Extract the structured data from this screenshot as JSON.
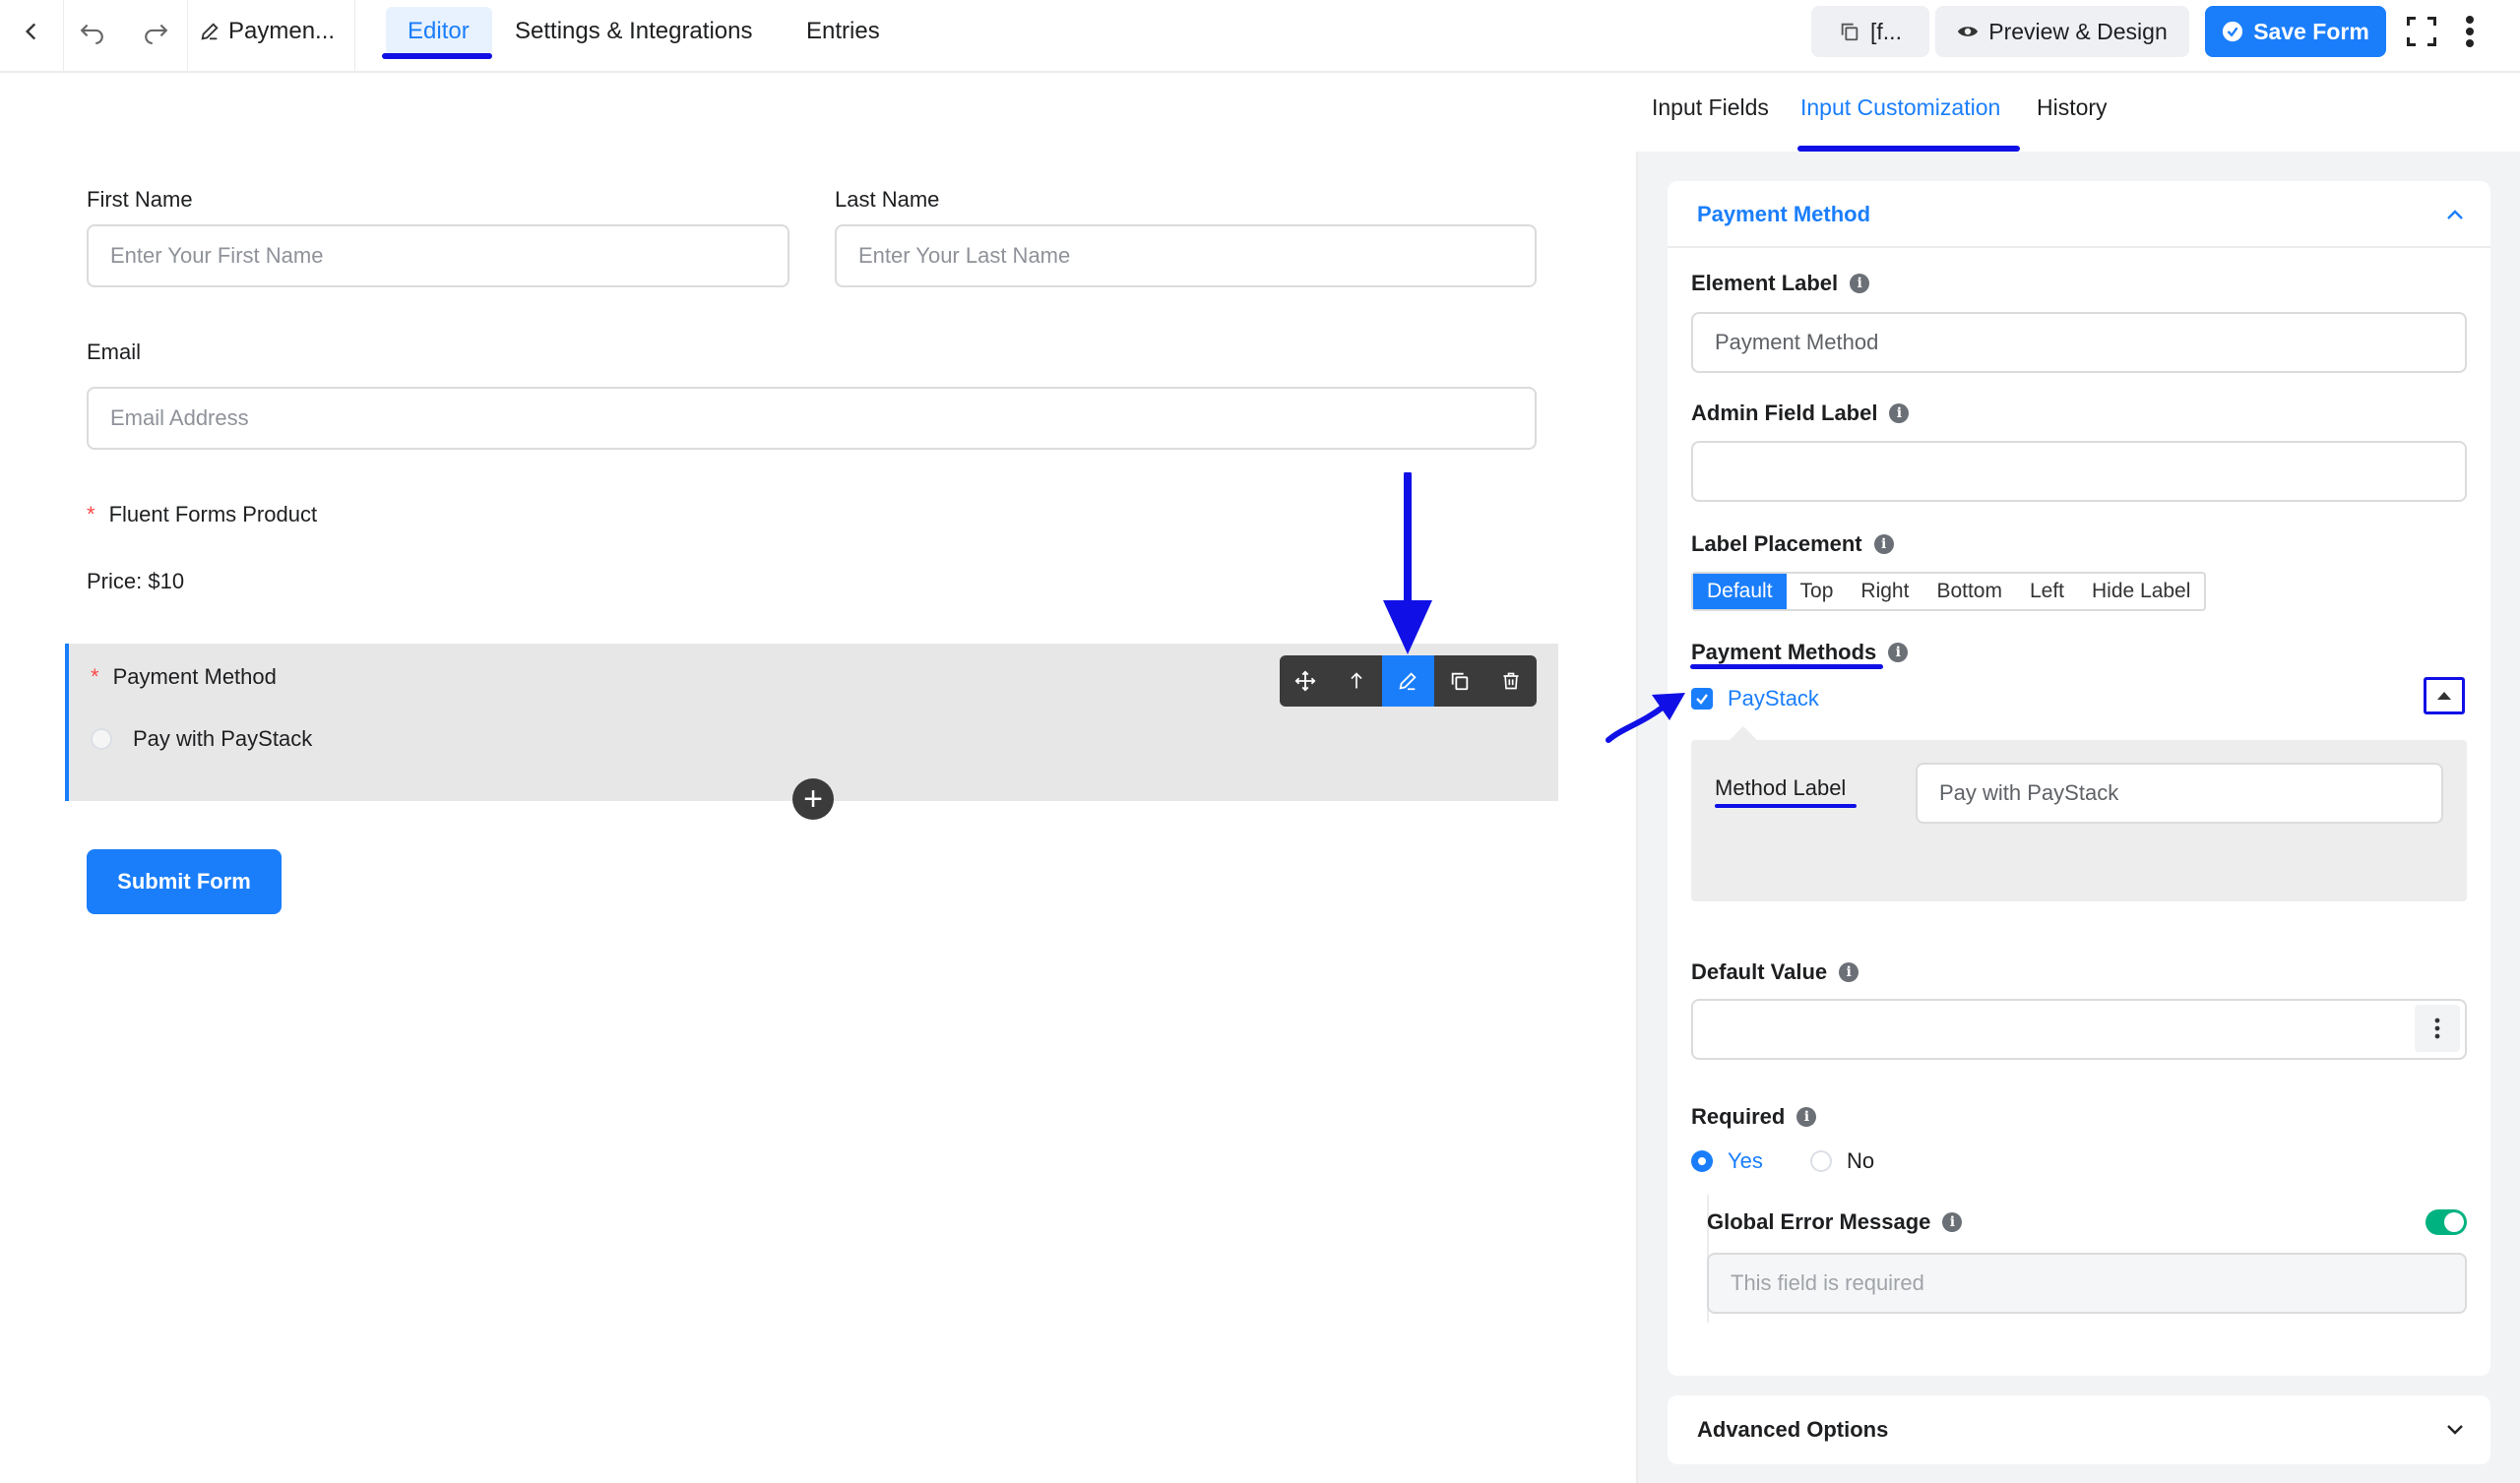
{
  "topbar": {
    "form_title": "Paymen...",
    "tabs": [
      {
        "label": "Editor",
        "active": true
      },
      {
        "label": "Settings & Integrations",
        "active": false
      },
      {
        "label": "Entries",
        "active": false
      }
    ],
    "shortcode_label": "[f...",
    "preview_label": "Preview & Design",
    "save_label": "Save Form"
  },
  "form": {
    "first_name_label": "First Name",
    "first_name_placeholder": "Enter Your First Name",
    "last_name_label": "Last Name",
    "last_name_placeholder": "Enter Your Last Name",
    "email_label": "Email",
    "email_placeholder": "Email Address",
    "product_label": "Fluent Forms Product",
    "price_text": "Price: $10",
    "payment_method_label": "Payment Method",
    "paystack_option": "Pay with PayStack",
    "submit_label": "Submit Form"
  },
  "panel": {
    "tabs": [
      {
        "label": "Input Fields",
        "active": false
      },
      {
        "label": "Input Customization",
        "active": true
      },
      {
        "label": "History",
        "active": false
      }
    ],
    "section_title": "Payment Method",
    "element_label_title": "Element Label",
    "element_label_value": "Payment Method",
    "admin_label_title": "Admin Field Label",
    "admin_label_value": "",
    "label_placement_title": "Label Placement",
    "placement_options": [
      "Default",
      "Top",
      "Right",
      "Bottom",
      "Left",
      "Hide Label"
    ],
    "placement_selected": "Default",
    "payment_methods_title": "Payment Methods",
    "paystack_name": "PayStack",
    "method_label_title": "Method Label",
    "method_label_value": "Pay with PayStack",
    "default_value_title": "Default Value",
    "required_title": "Required",
    "required_yes": "Yes",
    "required_no": "No",
    "global_error_title": "Global Error Message",
    "global_error_placeholder": "This field is required",
    "advanced_title": "Advanced Options"
  },
  "colors": {
    "accent": "#1a7efb",
    "annotation": "#1010e6",
    "toggle_on": "#00b27f"
  }
}
